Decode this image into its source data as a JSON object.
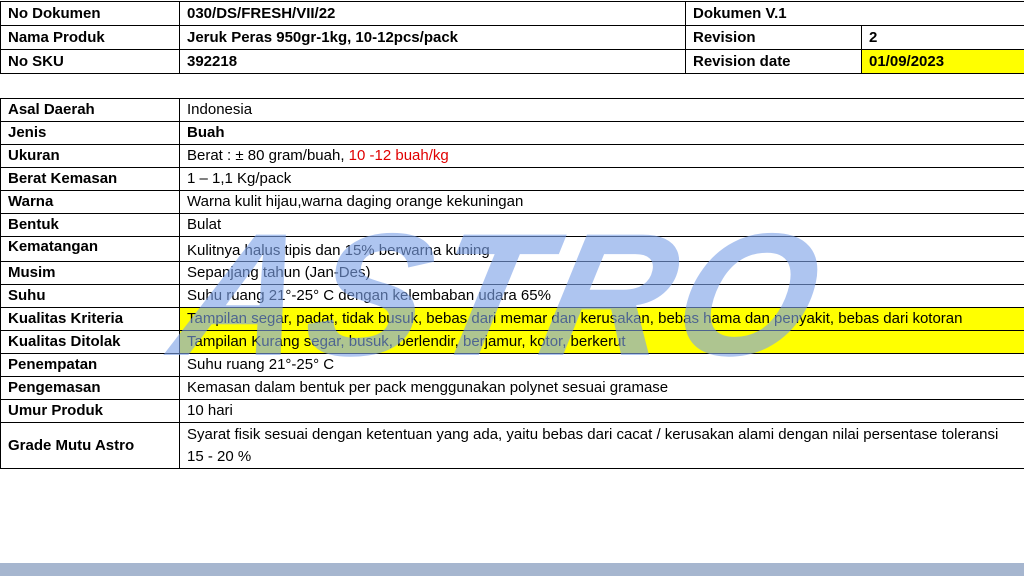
{
  "header": {
    "doc_no_label": "No Dokumen",
    "doc_no_value": "030/DS/FRESH/VII/22",
    "doc_version": "Dokumen V.1",
    "product_label": "Nama Produk",
    "product_value": "Jeruk Peras 950gr-1kg, 10-12pcs/pack",
    "revision_label": "Revision",
    "revision_value": "2",
    "sku_label": "No SKU",
    "sku_value": "392218",
    "revision_date_label": "Revision date",
    "revision_date_value": "01/09/2023"
  },
  "specs": {
    "asal_label": "Asal Daerah",
    "asal_value": "Indonesia",
    "jenis_label": "Jenis",
    "jenis_value": "Buah",
    "ukuran_label": "Ukuran",
    "ukuran_value_a": "Berat : ± 80 gram/buah, ",
    "ukuran_value_b": "10 -12 buah/kg",
    "berat_label": "Berat Kemasan",
    "berat_value": "1 – 1,1 Kg/pack",
    "warna_label": "Warna",
    "warna_value": "Warna kulit hijau,warna daging orange kekuningan",
    "bentuk_label": "Bentuk",
    "bentuk_value": "Bulat",
    "kematangan_label": "Kematangan",
    "kematangan_value": "Kulitnya halus tipis dan 15% berwarna kuning",
    "musim_label": "Musim",
    "musim_value": "Sepanjang tahun (Jan-Des)",
    "suhu_label": "Suhu",
    "suhu_value": "Suhu ruang 21°-25° C dengan kelembaban udara 65%",
    "kriteria_label": "Kualitas Kriteria",
    "kriteria_value": "Tampilan segar, padat, tidak busuk, bebas dari memar dan kerusakan, bebas hama dan penyakit, bebas dari kotoran",
    "ditolak_label": "Kualitas Ditolak",
    "ditolak_value": "Tampilan Kurang segar, busuk, berlendir, berjamur, kotor, berkerut",
    "penempatan_label": "Penempatan",
    "penempatan_value": "Suhu ruang 21°-25° C",
    "pengemasan_label": "Pengemasan",
    "pengemasan_value": "Kemasan dalam bentuk per pack menggunakan polynet sesuai gramase",
    "umur_label": "Umur Produk",
    "umur_value": "10 hari",
    "grade_label": "Grade Mutu Astro",
    "grade_value": "Syarat fisik sesuai dengan ketentuan yang ada, yaitu bebas dari cacat / kerusakan alami dengan nilai persentase toleransi 15 - 20 %"
  },
  "watermark": {
    "text": "ASTRO",
    "color": "#7da2e8"
  },
  "colors": {
    "highlight": "#ffff00",
    "accent_red": "#e00000",
    "bottom_bar": "#a6b6cf"
  }
}
